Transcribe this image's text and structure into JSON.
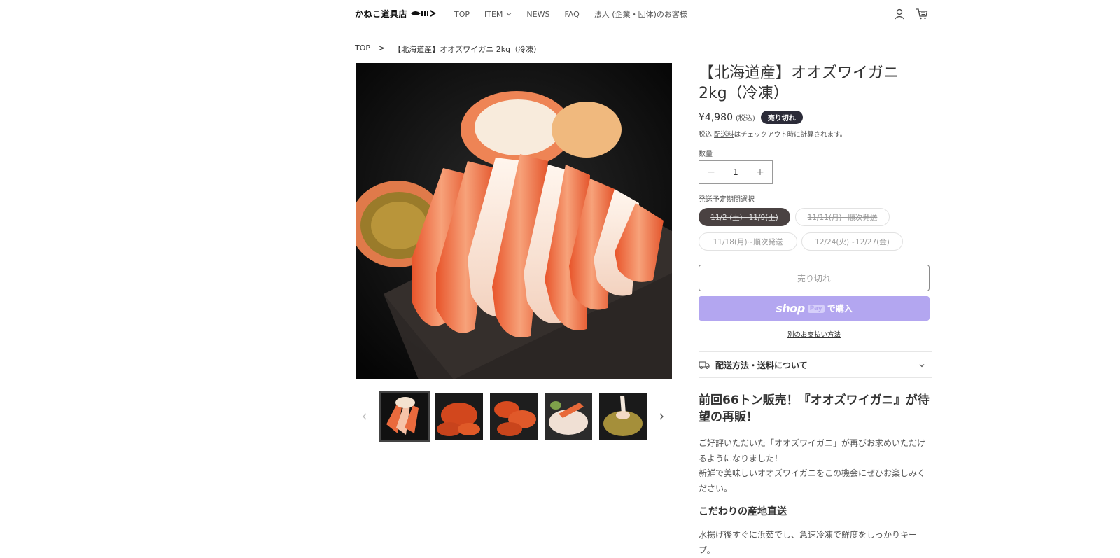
{
  "header": {
    "logo_text": "かねこ道具店",
    "nav": [
      {
        "label": "TOP"
      },
      {
        "label": "ITEM"
      },
      {
        "label": "NEWS"
      },
      {
        "label": "FAQ"
      },
      {
        "label": "法人 (企業・団体)のお客様"
      }
    ],
    "icons": [
      "account-icon",
      "cart-icon"
    ]
  },
  "breadcrumb": {
    "home": "TOP",
    "separator": ">",
    "current": "【北海道産】オオズワイガニ 2kg（冷凍）"
  },
  "product": {
    "title": "【北海道産】オオズワイガニ 2kg（冷凍）",
    "price": "¥4,980",
    "price_tax": "(税込)",
    "sold_out_badge": "売り切れ",
    "tax_note_prefix": "税込",
    "tax_note_link": "配送料",
    "tax_note_suffix": "はチェックアウト時に計算されます。",
    "quantity_label": "数量",
    "quantity_value": "1",
    "quantity_minus": "−",
    "quantity_plus": "+",
    "shipping_period_label": "発送予定期間選択",
    "variants": [
      {
        "label": "11/2 (土)~11/9(土)",
        "selected": true
      },
      {
        "label": "11/11(月)~順次発送",
        "selected": false
      },
      {
        "label": "11/18(月)~順次発送",
        "selected": false
      },
      {
        "label": "12/24(火)~12/27(金)",
        "selected": false
      }
    ],
    "soldout_button": "売り切れ",
    "shoppay_shop": "shop",
    "shoppay_pay": "Pay",
    "shoppay_text": "で購入",
    "other_payment": "別のお支払い方法",
    "shipping_accordion": "配送方法・送料について"
  },
  "description": {
    "heading": "前回66トン販売！『オオズワイガニ』が待望の再販！",
    "para1_line1": "ご好評いただいた「オオズワイガニ」が再びお求めいただけるようになりました！",
    "para1_line2": "新鮮で美味しいオオズワイガニをこの機会にぜひお楽しみください。",
    "subheading": "こだわりの産地直送",
    "para2": "水揚げ後すぐに浜茹でし、急速冷凍で鮮度をしっかりキープ。"
  },
  "gallery": {
    "thumbnail_count": 5,
    "active_index": 0
  },
  "colors": {
    "badge_bg": "#2b2b38",
    "selected_variant_bg": "#4a4242",
    "shoppay": "#b3a6f0"
  }
}
